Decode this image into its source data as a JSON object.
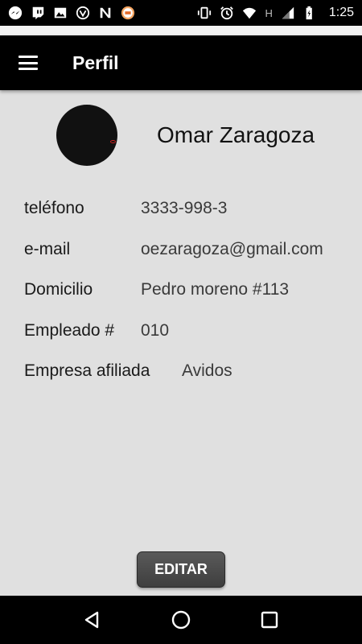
{
  "status_bar": {
    "time": "1:25",
    "network_letter": "H",
    "left_icons": [
      "messenger-icon",
      "twitch-icon",
      "photo-icon",
      "vpn-icon",
      "n-app-icon",
      "cpu-icon"
    ],
    "right_icons": [
      "vibrate-icon",
      "alarm-icon",
      "wifi-icon",
      "signal-icon",
      "battery-icon"
    ]
  },
  "app_bar": {
    "title": "Perfil",
    "menu_icon": "hamburger-menu-icon"
  },
  "profile": {
    "name": "Omar Zaragoza",
    "avatar_color": "#111111"
  },
  "fields": [
    {
      "label": "teléfono",
      "value": "3333-998-3"
    },
    {
      "label": "e-mail",
      "value": "oezaragoza@gmail.com"
    },
    {
      "label": "Domicilio",
      "value": "Pedro moreno #113"
    },
    {
      "label": "Empleado #",
      "value": "010"
    },
    {
      "label": "Empresa afiliada",
      "value": "Avidos"
    }
  ],
  "actions": {
    "edit_label": "EDITAR"
  },
  "nav_bar": {
    "icons": [
      "back-icon",
      "home-icon",
      "recents-icon"
    ]
  },
  "colors": {
    "app_bar": "#000000",
    "background": "#e0e0e0",
    "button": "#4a4a4a"
  }
}
